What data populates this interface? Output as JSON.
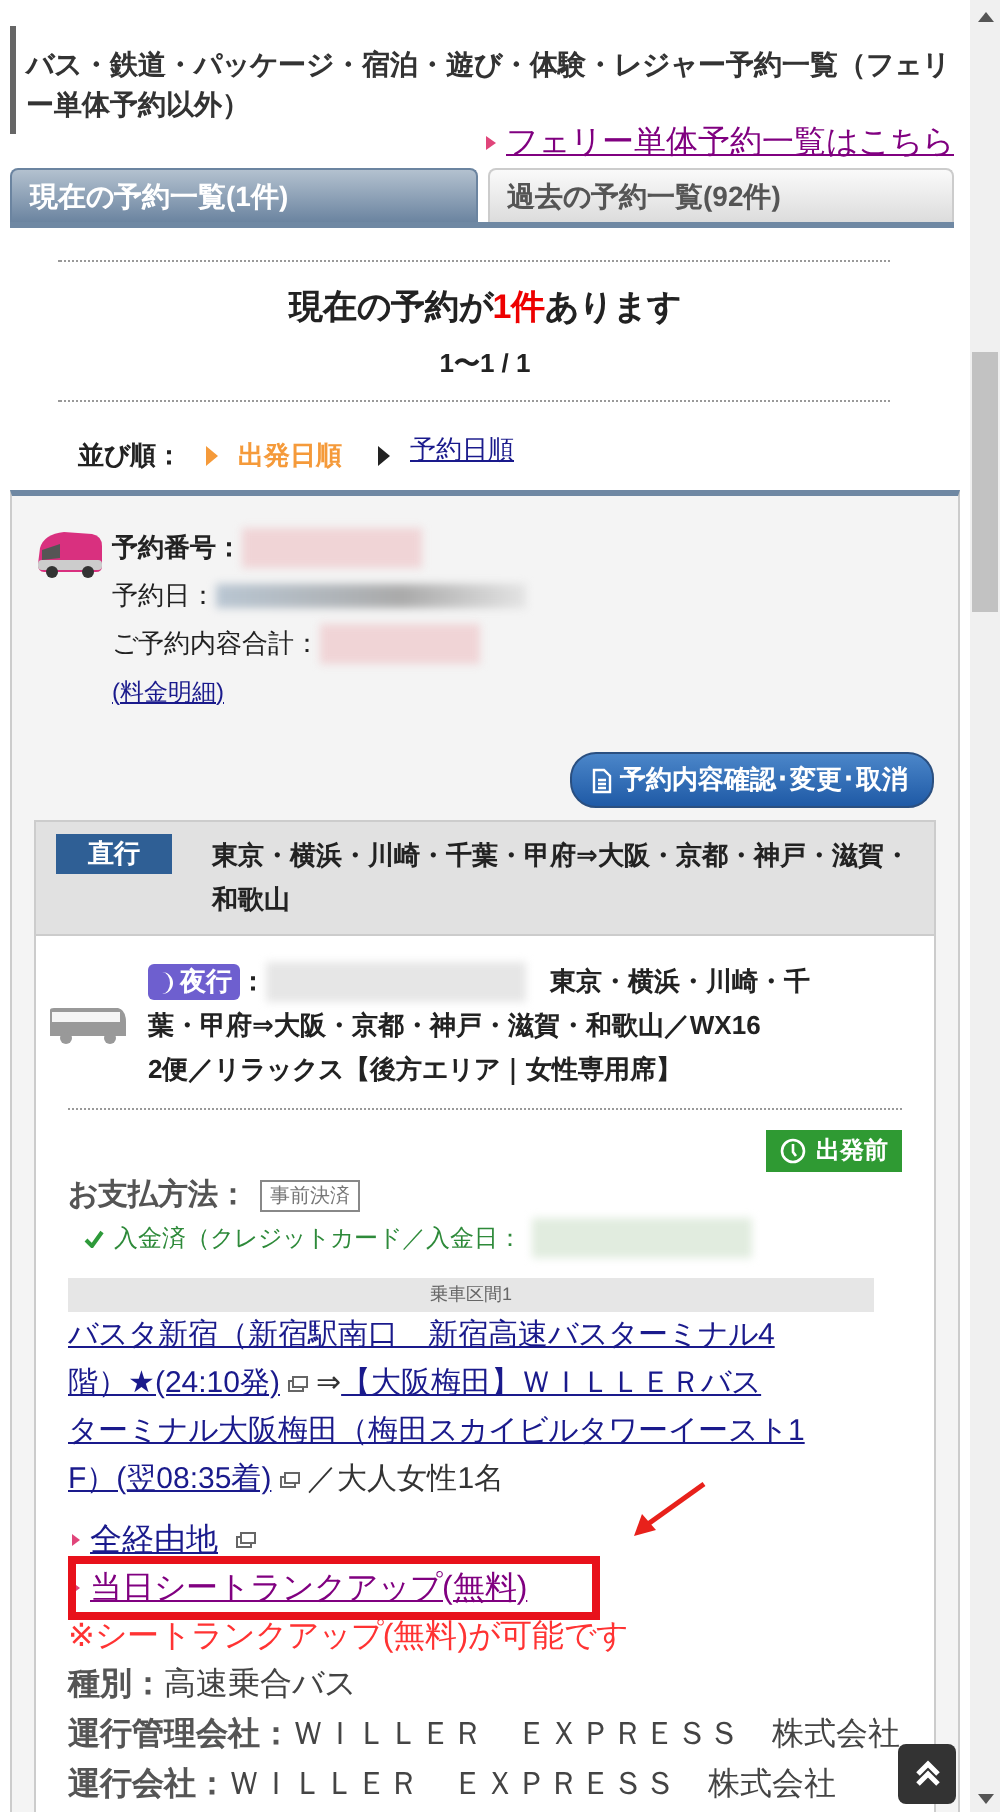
{
  "page_title": "バス・鉄道・パッケージ・宿泊・遊び・体験・レジャー予約一覧（フェリー単体予約以外）",
  "ferry_link": "フェリー単体予約一覧はこちら",
  "tabs": [
    {
      "label": "現在の予約一覧(1件)",
      "selected": true
    },
    {
      "label": "過去の予約一覧(92件)",
      "selected": false
    }
  ],
  "summary": {
    "heading_before": "現在の予約が",
    "heading_count": "1件",
    "heading_after": "あります",
    "pagination": "1〜1 / 1"
  },
  "sort": {
    "label": "並び順：",
    "options": [
      {
        "label": "出発日順",
        "selected": true
      },
      {
        "label": "予約日順",
        "selected": false
      }
    ]
  },
  "reservation": {
    "number_label": "予約番号：",
    "date_label": "予約日：",
    "total_label": "ご予約内容合計：",
    "fee_link": "(料金明細)",
    "manage_button": "予約内容確認･変更･取消",
    "trip": {
      "type_badge": "直行",
      "route": "東京・横浜・川崎・千葉・甲府⇒大阪・京都・神戸・滋賀・和歌山"
    },
    "bus": {
      "night_badge": "夜行",
      "separator": "：",
      "detail_lines": [
        "東京・横浜・川崎・千",
        "葉・甲府⇒大阪・京都・神戸・滋賀・和歌山／WX16",
        "2便／リラックス【後方エリア｜女性専用席】"
      ]
    },
    "status": "出発前",
    "payment": {
      "label": "お支払方法：",
      "tag": "事前決済",
      "paid": "入金済（クレジットカード／入金日："
    },
    "segment": {
      "header": "乗車区間1",
      "from_lines": [
        "バスタ新宿（新宿駅南口　新宿高速バスターミナル4",
        "階）★(24:10発)"
      ],
      "arrow": "⇒",
      "to_lines": [
        "【大阪梅田】ＷＩＬＬＥＲバス",
        "ターミナル大阪梅田（梅田スカイビルタワーイースト1",
        "F）(翌08:35着)"
      ],
      "passengers": "／大人女性1名"
    },
    "links": [
      {
        "label": "全経由地",
        "highlighted": false
      },
      {
        "label": "当日シートランクアップ(無料)",
        "highlighted": true
      }
    ],
    "note": "※シートランクアップ(無料)が可能です",
    "info": [
      {
        "label": "種別：",
        "value": "高速乗合バス"
      },
      {
        "label": "運行管理会社：",
        "value": "ＷＩＬＬＥＲ　ＥＸＰＲＥＳＳ　株式会社"
      },
      {
        "label": "運行会社：",
        "value": "ＷＩＬＬＥＲ　ＥＸＰＲＥＳＳ　株式会社"
      }
    ]
  }
}
